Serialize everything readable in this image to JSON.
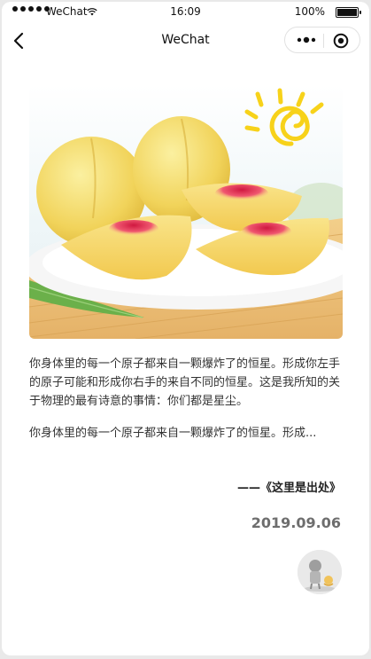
{
  "status_bar": {
    "carrier": "WeChat",
    "time": "16:09",
    "battery": "100%",
    "battery_level": 1.0,
    "signal_bars": 5
  },
  "navbar": {
    "title": "WeChat"
  },
  "article": {
    "paragraph_1": "你身体里的每一个原子都来自一颗爆炸了的恒星。形成你左手的原子可能和形成你右手的来自不同的恒星。这是我所知的关于物理的最有诗意的事情：你们都是星尘。",
    "paragraph_2": "你身体里的每一个原子都来自一颗爆炸了的恒星。形成...",
    "source": "——《这里是出处》",
    "date": "2019.09.06"
  },
  "icons": {
    "back": "back-arrow-icon",
    "more": "more-dots-icon",
    "close": "target-close-icon",
    "wifi": "wifi-icon"
  }
}
